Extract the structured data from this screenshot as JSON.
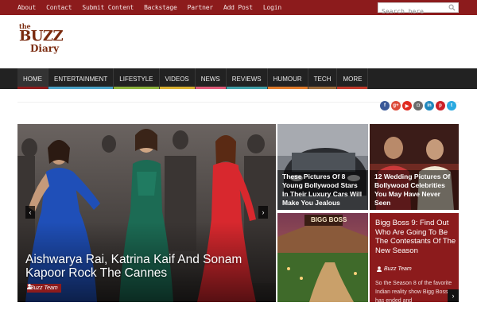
{
  "topbar": {
    "links": [
      "About",
      "Contact",
      "Submit Content",
      "Backstage",
      "Partner",
      "Add Post",
      "Login"
    ],
    "search_placeholder": "Search here"
  },
  "logo": {
    "line1": "the",
    "line2": "BUZZ",
    "line3": "Diary"
  },
  "nav": {
    "items": [
      {
        "label": "HOME",
        "color": "#8c1b1c"
      },
      {
        "label": "ENTERTAINMENT",
        "color": "#4aa3c8"
      },
      {
        "label": "LIFESTYLE",
        "color": "#8cb33c"
      },
      {
        "label": "VIDEOS",
        "color": "#d8b030"
      },
      {
        "label": "NEWS",
        "color": "#e05a78"
      },
      {
        "label": "REVIEWS",
        "color": "#3fa0a8"
      },
      {
        "label": "HUMOUR",
        "color": "#e07a2a"
      },
      {
        "label": "TECH",
        "color": "#9a6a3a"
      },
      {
        "label": "MORE",
        "color": "#c0392b"
      }
    ]
  },
  "social": [
    {
      "icon": "facebook-icon",
      "glyph": "f",
      "color": "#3b5998"
    },
    {
      "icon": "google-plus-icon",
      "glyph": "g+",
      "color": "#dd4b39"
    },
    {
      "icon": "youtube-icon",
      "glyph": "▶",
      "color": "#e02a20"
    },
    {
      "icon": "instagram-icon",
      "glyph": "◘",
      "color": "#6b6b6b"
    },
    {
      "icon": "linkedin-icon",
      "glyph": "in",
      "color": "#1f88be"
    },
    {
      "icon": "pinterest-icon",
      "glyph": "p",
      "color": "#cb2027"
    },
    {
      "icon": "twitter-icon",
      "glyph": "t",
      "color": "#2aa9e0"
    }
  ],
  "featured": {
    "title": "Aishwarya Rai, Katrina Kaif And Sonam Kapoor Rock The Cannes",
    "author": "Buzz Team"
  },
  "cards": [
    {
      "caption": "These Pictures Of 8 Young Bollywood Stars In Their Luxury Cars Will Make You Jealous"
    },
    {
      "caption": "12 Wedding Pictures Of Bollywood Celebrities You May Have Never Seen"
    },
    {
      "sign": "BIGG BOSS"
    }
  ],
  "red_card": {
    "title": "Bigg Boss 9: Find Out Who Are Going To Be The Contestants Of The New Season",
    "author": "Buzz Team",
    "excerpt": "So the Season 8 of the favorite Indian reality show Bigg Boss has ended and"
  }
}
